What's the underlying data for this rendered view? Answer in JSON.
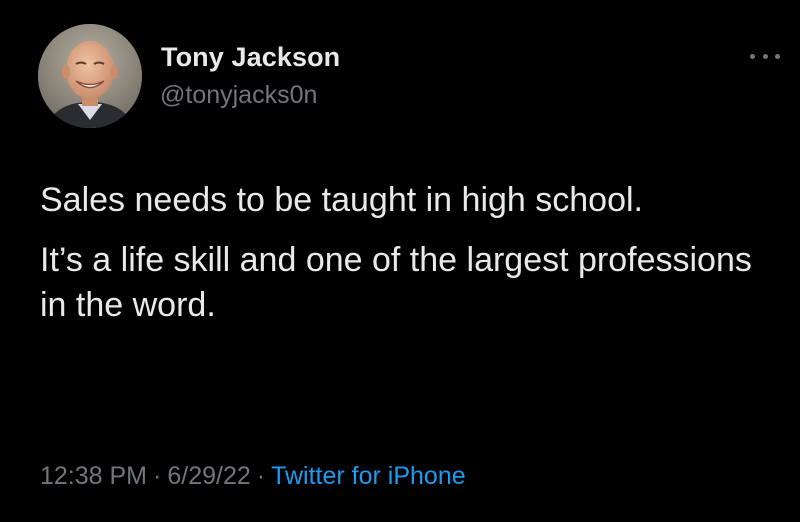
{
  "author": {
    "name": "Tony Jackson",
    "handle": "@tonyjacks0n",
    "avatar_icon": "avatar-photo"
  },
  "menu": {
    "icon": "more-horizontal-icon"
  },
  "tweet": {
    "paragraphs": [
      "Sales needs to be taught in high school.",
      "It’s a life skill and one of the largest professions in the word."
    ]
  },
  "meta": {
    "time": "12:38 PM",
    "separator": "·",
    "date": "6/29/22",
    "source": "Twitter for iPhone"
  },
  "colors": {
    "background": "#000000",
    "primary_text": "#e7e9ea",
    "secondary_text": "#71767b",
    "link": "#1d9bf0"
  }
}
